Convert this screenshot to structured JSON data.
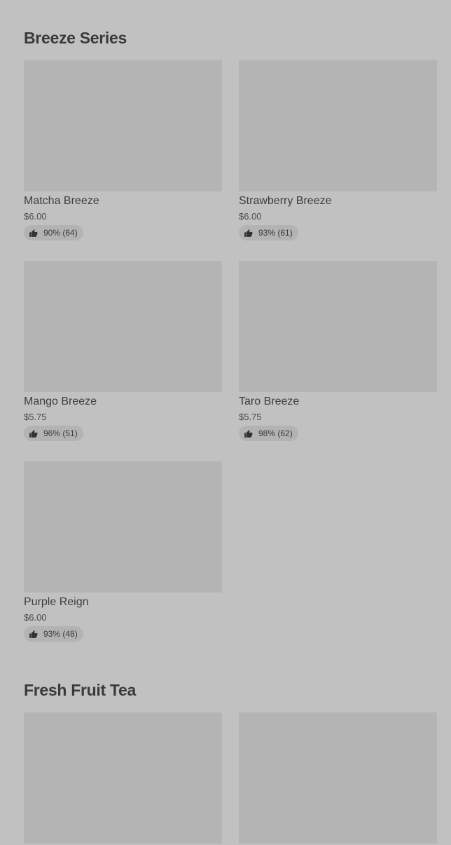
{
  "sections": [
    {
      "title": "Breeze Series",
      "items": [
        {
          "name": "Matcha Breeze",
          "price": "$6.00",
          "rating": "90% (64)"
        },
        {
          "name": "Strawberry Breeze",
          "price": "$6.00",
          "rating": "93% (61)"
        },
        {
          "name": "Mango Breeze",
          "price": "$5.75",
          "rating": "96% (51)"
        },
        {
          "name": "Taro Breeze",
          "price": "$5.75",
          "rating": "98% (62)"
        },
        {
          "name": "Purple Reign",
          "price": "$6.00",
          "rating": "93% (48)"
        }
      ]
    },
    {
      "title": "Fresh Fruit Tea",
      "items": [
        {
          "name": "",
          "price": "",
          "rating": ""
        },
        {
          "name": "",
          "price": "",
          "rating": ""
        }
      ]
    }
  ],
  "icons": {
    "rating": "thumbs-up-icon"
  },
  "colors": {
    "background": "#c1c1c1",
    "placeholder": "#b4b4b4",
    "pill": "#b3b3b3",
    "text": "#333333"
  }
}
